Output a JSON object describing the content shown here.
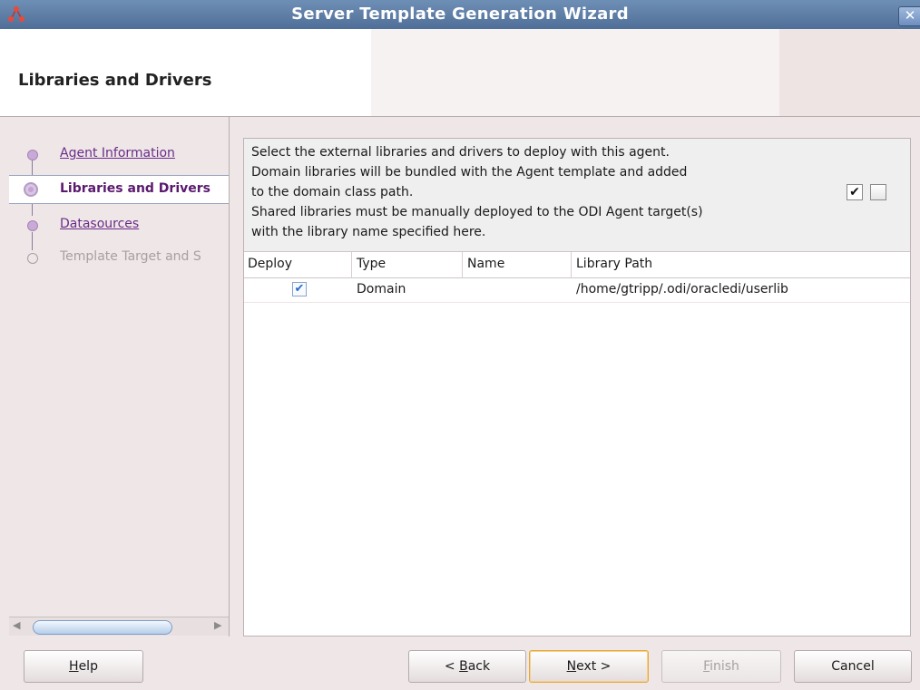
{
  "window": {
    "title": "Server Template Generation Wizard",
    "close_label": "✕"
  },
  "header": {
    "page_title": "Libraries and Drivers"
  },
  "nav": {
    "items": [
      {
        "label": "Agent Information",
        "state": "link"
      },
      {
        "label": "Libraries and Drivers",
        "state": "current"
      },
      {
        "label": "Datasources",
        "state": "link"
      },
      {
        "label": "Template Target and S",
        "state": "disabled"
      }
    ]
  },
  "instructions": {
    "lines": [
      "Select the external libraries and drivers to deploy with this agent.",
      "Domain libraries will be bundled with the Agent template and added",
      "to the domain class path.",
      "Shared libraries must be manually deployed to the ODI Agent target(s)",
      "with the library name specified here."
    ],
    "select_all_glyph": "✔"
  },
  "table": {
    "columns": [
      "Deploy",
      "Type",
      "Name",
      "Library Path"
    ],
    "rows": [
      {
        "deploy": true,
        "deploy_glyph": "✔",
        "type": "Domain",
        "name": "",
        "path": "/home/gtripp/.odi/oracledi/userlib"
      }
    ]
  },
  "footer": {
    "help": {
      "mnemonic": "H",
      "rest": "elp"
    },
    "back": {
      "pre": "< ",
      "mnemonic": "B",
      "rest": "ack"
    },
    "next": {
      "mnemonic": "N",
      "rest": "ext >"
    },
    "finish": {
      "mnemonic": "F",
      "rest": "inish"
    },
    "cancel": "Cancel"
  },
  "colors": {
    "titlebar": "#4f6f98",
    "link": "#6a2c8a",
    "focus_border": "#e6a63a"
  }
}
